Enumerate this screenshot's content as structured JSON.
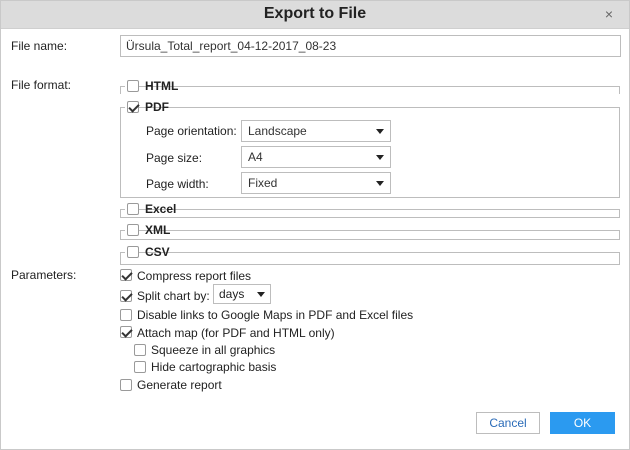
{
  "dialog": {
    "title": "Export to File",
    "close_symbol": "×"
  },
  "file_name": {
    "label": "File name:",
    "value": "Ürsula_Total_report_04-12-2017_08-23"
  },
  "file_format": {
    "label": "File format:",
    "html": {
      "label": "HTML",
      "checked": false
    },
    "pdf": {
      "label": "PDF",
      "checked": true,
      "orientation": {
        "label": "Page orientation:",
        "value": "Landscape"
      },
      "size": {
        "label": "Page size:",
        "value": "A4"
      },
      "width": {
        "label": "Page width:",
        "value": "Fixed"
      }
    },
    "excel": {
      "label": "Excel",
      "checked": false
    },
    "xml": {
      "label": "XML",
      "checked": false
    },
    "csv": {
      "label": "CSV",
      "checked": false
    }
  },
  "parameters": {
    "label": "Parameters:",
    "compress": {
      "label": "Compress report files",
      "checked": true
    },
    "split_chart": {
      "label": "Split chart by:",
      "checked": true,
      "value": "days"
    },
    "disable_links": {
      "label": "Disable links to Google Maps in PDF and Excel files",
      "checked": false
    },
    "attach_map": {
      "label": "Attach map (for PDF and HTML only)",
      "checked": true
    },
    "squeeze": {
      "label": "Squeeze in all graphics",
      "checked": false
    },
    "hide_basis": {
      "label": "Hide cartographic basis",
      "checked": false
    },
    "generate": {
      "label": "Generate report",
      "checked": false
    }
  },
  "buttons": {
    "cancel": "Cancel",
    "ok": "OK"
  }
}
